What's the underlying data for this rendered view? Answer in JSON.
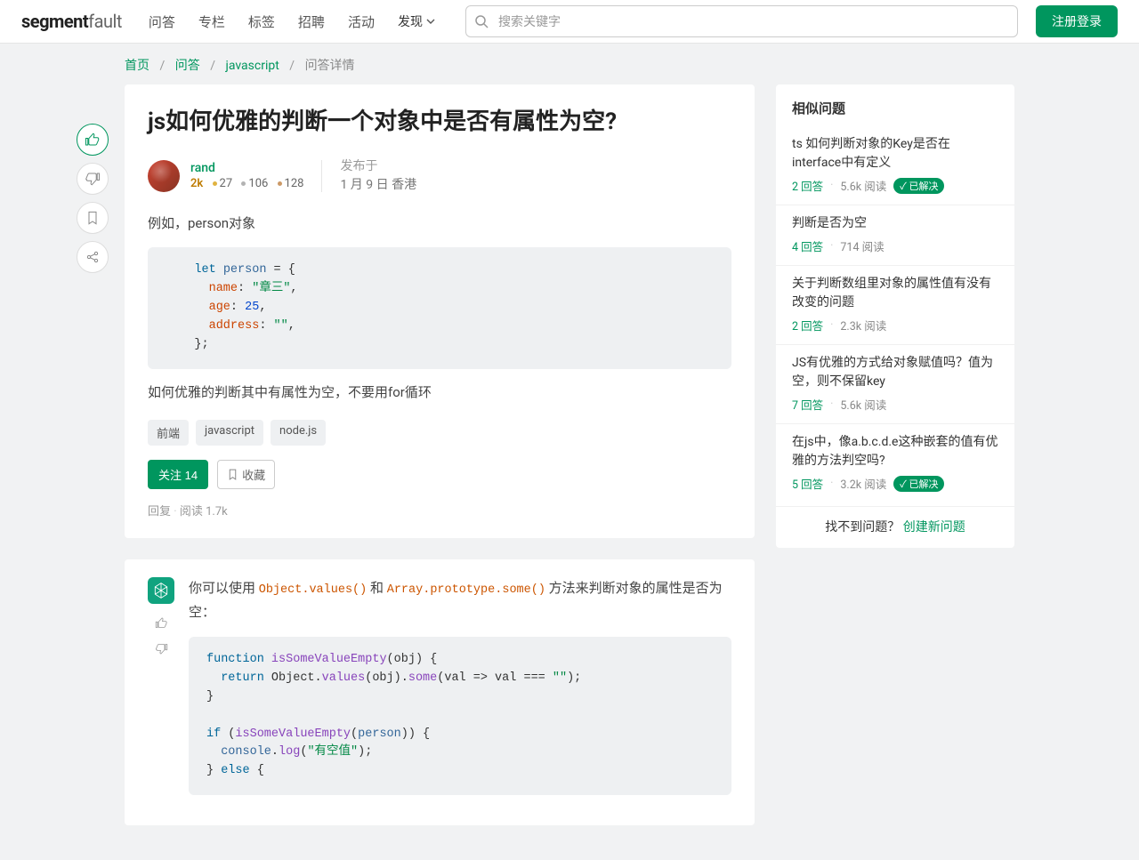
{
  "brand": {
    "seg": "segment",
    "fault": "fault"
  },
  "nav": [
    "问答",
    "专栏",
    "标签",
    "招聘",
    "活动",
    "发现"
  ],
  "search_placeholder": "搜索关键字",
  "login_btn": "注册登录",
  "breadcrumb": {
    "items": [
      "首页",
      "问答",
      "javascript"
    ],
    "current": "问答详情"
  },
  "question": {
    "title": "js如何优雅的判断一个对象中是否有属性为空?",
    "author": {
      "name": "rand",
      "rep": "2k",
      "gold": "27",
      "silver": "106",
      "bronze": "128"
    },
    "pub_label": "发布于",
    "pub_time": "1 月 9 日 香港",
    "body_before": "例如，person对象",
    "code": "    let person = {\n      name: \"章三\",\n      age: 25,\n      address: \"\",\n    };",
    "body_after": "如何优雅的判断其中有属性为空，不要用for循环",
    "tags": [
      "前端",
      "javascript",
      "node.js"
    ],
    "follow_label": "关注 14",
    "fav_label": "收藏",
    "reply_label": "回复",
    "views_label": "阅读 1.7k"
  },
  "answer": {
    "text_before": "你可以使用 ",
    "inline1": "Object.values()",
    "text_mid": " 和 ",
    "inline2": "Array.prototype.some()",
    "text_after": " 方法来判断对象的属性是否为空：",
    "code": "function isSomeValueEmpty(obj) {\n  return Object.values(obj).some(val => val === \"\");\n}\n\nif (isSomeValueEmpty(person)) {\n  console.log(\"有空值\");\n} else {"
  },
  "sidebar": {
    "title": "相似问题",
    "items": [
      {
        "title": "ts 如何判断对象的Key是否在interface中有定义",
        "answers": "2 回答",
        "reads": "5.6k 阅读",
        "solved": true
      },
      {
        "title": "判断是否为空",
        "answers": "4 回答",
        "reads": "714 阅读",
        "solved": false
      },
      {
        "title": "关于判断数组里对象的属性值有没有改变的问题",
        "answers": "2 回答",
        "reads": "2.3k 阅读",
        "solved": false
      },
      {
        "title": "JS有优雅的方式给对象赋值吗？值为空，则不保留key",
        "answers": "7 回答",
        "reads": "5.6k 阅读",
        "solved": false
      },
      {
        "title": "在js中，像a.b.c.d.e这种嵌套的值有优雅的方法判空吗?",
        "answers": "5 回答",
        "reads": "3.2k 阅读",
        "solved": true
      }
    ],
    "solved_label": "已解决",
    "footer_text": "找不到问题？",
    "footer_link": "创建新问题"
  }
}
